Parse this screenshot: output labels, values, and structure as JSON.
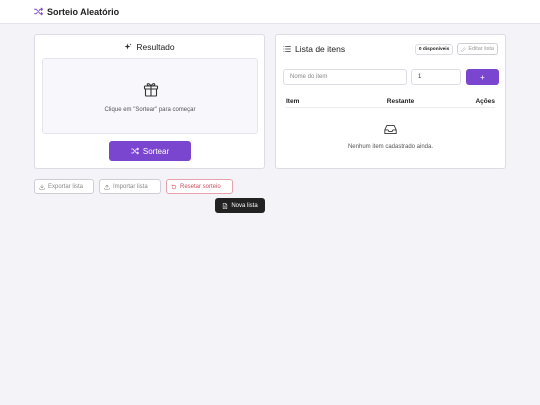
{
  "app": {
    "title": "Sorteio Aleatório",
    "accent": "#7a45cf",
    "brand_icon": "shuffle-icon"
  },
  "result_card": {
    "title": "Resultado",
    "title_icon": "sparkles-icon",
    "hint": "Clique em \"Sortear\" para começar",
    "placeholder_icon": "gift-icon",
    "sort_button": "Sortear"
  },
  "list_card": {
    "title": "Lista de itens",
    "available_badge": "0 disponíveis",
    "edit_button": "Editar lista",
    "name_input_placeholder": "Nome do item",
    "quantity_value": "1",
    "add_button": "+",
    "columns": [
      "Item",
      "Restante",
      "Ações"
    ],
    "empty_text": "Nenhum item cadastrado ainda."
  },
  "actions": {
    "export": "Exportar lista",
    "import": "Importar lista",
    "reset": "Resetar sorteio"
  },
  "tooltip": {
    "text": "Nova lista"
  }
}
